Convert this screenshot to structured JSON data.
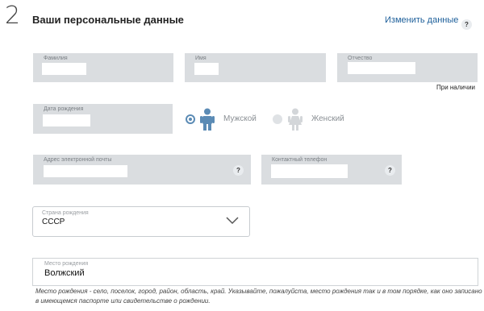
{
  "section": {
    "step_number": "2",
    "title": "Ваши персональные данные",
    "change_link": "Изменить данные",
    "help_symbol": "?"
  },
  "fields": {
    "surname": {
      "label": "Фамилия",
      "value": ""
    },
    "name": {
      "label": "Имя",
      "value": ""
    },
    "patronymic": {
      "label": "Отчество",
      "value": "",
      "note": "При наличии"
    },
    "birth_date": {
      "label": "Дата рождения",
      "value": ""
    },
    "email": {
      "label": "Адрес электронной почты",
      "value": ""
    },
    "phone": {
      "label": "Контактный телефон",
      "value": ""
    },
    "birth_country": {
      "label": "Страна рождения",
      "value": "СССР"
    },
    "birth_place": {
      "label": "Место рождения",
      "value": "Волжский"
    }
  },
  "gender": {
    "male_label": "Мужской",
    "female_label": "Женский",
    "selected": "male"
  },
  "birth_place_hint": "Место рождения - село, поселок, город, район, область, край. Указывайте, пожалуйста, место рождения так и в том порядке, как оно записано в имеющемся паспорте или свидетельстве о рождении.",
  "colors": {
    "accent": "#5b8bb5",
    "link": "#1d5f9a",
    "field_bg": "#dadde0"
  }
}
